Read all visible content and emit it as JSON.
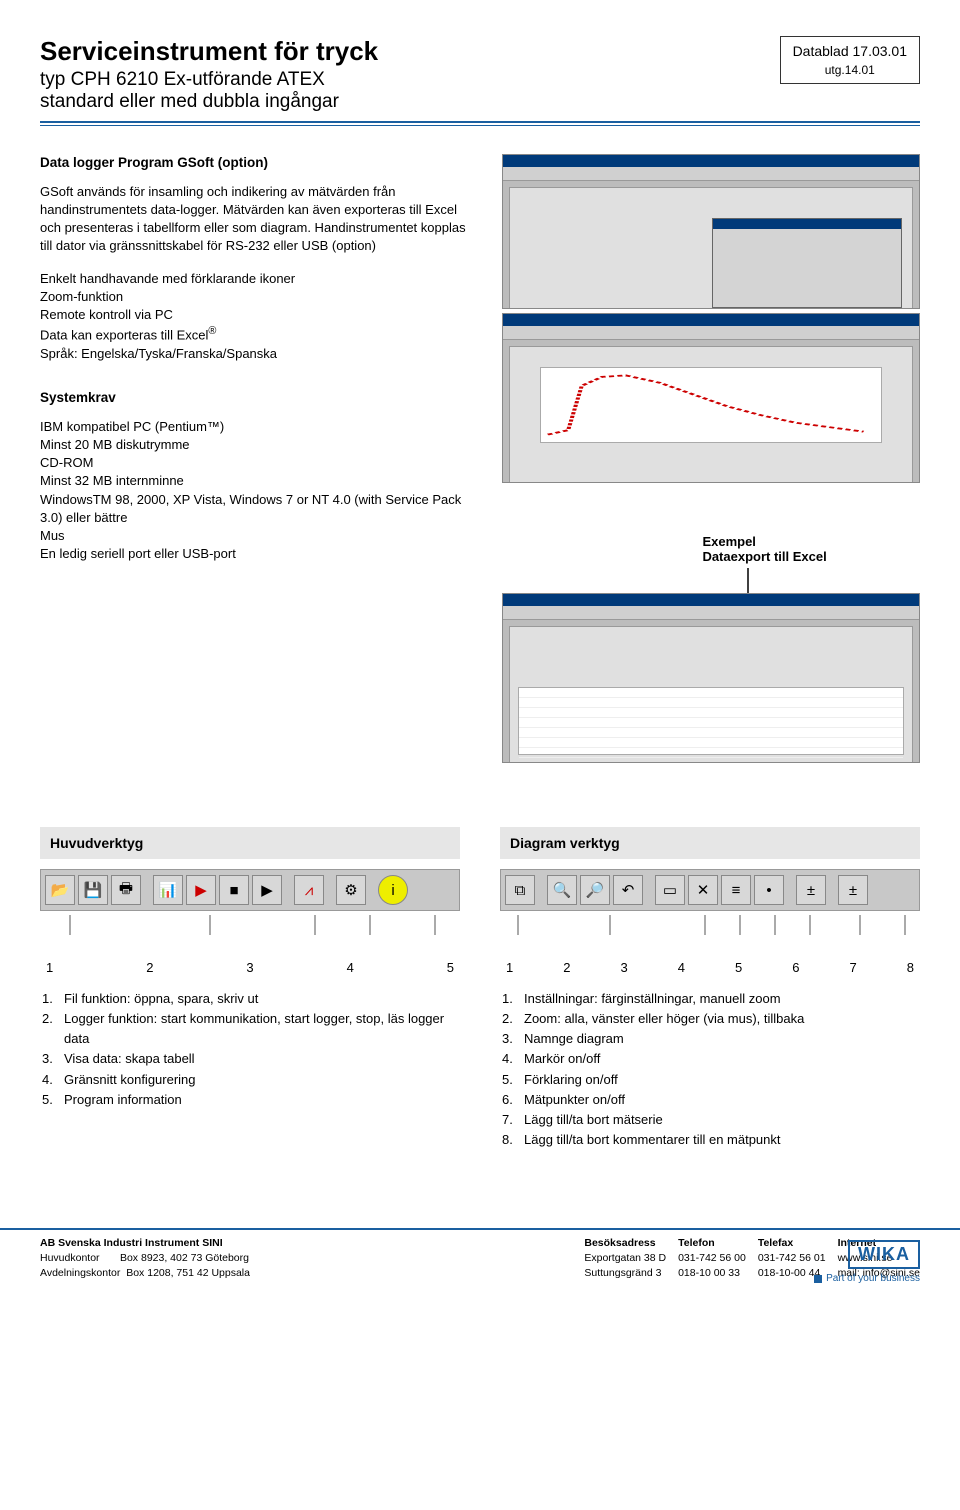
{
  "header": {
    "title": "Serviceinstrument för tryck",
    "subtitle1": "typ CPH 6210 Ex-utförande ATEX",
    "subtitle2": "standard eller med dubbla ingångar",
    "datablad": "Datablad 17.03.01",
    "utg": "utg.14.01"
  },
  "section1": {
    "heading": "Data logger Program GSoft (option)",
    "p1": "GSoft används för insamling och indikering av mätvärden från handinstrumentets data-logger. Mätvärden kan även exporteras till Excel och presenteras i tabellform eller som diagram. Handinstrumentet kopplas till dator via gränssnittskabel för RS-232 eller USB (option)",
    "feat1": "Enkelt handhavande med förklarande ikoner",
    "feat2": "Zoom-funktion",
    "feat3": "Remote kontroll via PC",
    "feat4": "Data kan exporteras till Excel",
    "feat4_sup": "®",
    "feat5": "Språk: Engelska/Tyska/Franska/Spanska"
  },
  "section2": {
    "heading": "Systemkrav",
    "l1": "IBM kompatibel PC (Pentium™)",
    "l2": "Minst 20 MB diskutrymme",
    "l3": "CD-ROM",
    "l4": "Minst 32 MB internminne",
    "l5": "WindowsTM 98, 2000, XP Vista, Windows 7 or NT 4.0 (with Service Pack 3.0) eller bättre",
    "l6": "Mus",
    "l7": "En ledig seriell port eller USB-port"
  },
  "example": {
    "l1": "Exempel",
    "l2": "Dataexport till Excel"
  },
  "tools": {
    "left_header": "Huvudverktyg",
    "right_header": "Diagram verktyg",
    "left_nums": [
      "1",
      "2",
      "3",
      "4",
      "5"
    ],
    "right_nums": [
      "1",
      "2",
      "3",
      "4",
      "5",
      "6",
      "7",
      "8"
    ],
    "left_desc": [
      "Fil funktion: öppna, spara, skriv ut",
      "Logger funktion: start kommunikation, start logger, stop, läs logger data",
      "Visa data: skapa tabell",
      "Gränsnitt konfigurering",
      "Program information"
    ],
    "right_desc": [
      "Inställningar: färginställningar, manuell zoom",
      "Zoom: alla, vänster eller höger (via mus), tillbaka",
      "Namnge diagram",
      "Markör on/off",
      "Förklaring on/off",
      "Mätpunkter on/off",
      "Lägg till/ta bort mätserie",
      "Lägg till/ta bort kommentarer till en mätpunkt"
    ]
  },
  "footer": {
    "company": "AB Svenska Industri Instrument SINI",
    "hk_label": "Huvudkontor",
    "hk_val": "Box 8923, 402 73 Göteborg",
    "ak_label": "Avdelningskontor",
    "ak_val": "Box 1208, 751 42 Uppsala",
    "besok_h": "Besöksadress",
    "besok_1": "Exportgatan 38 D",
    "besok_2": "Suttungsgränd 3",
    "tel_h": "Telefon",
    "tel_1": "031-742 56 00",
    "tel_2": "018-10 00 33",
    "fax_h": "Telefax",
    "fax_1": "031-742 56 01",
    "fax_2": "018-10-00 44",
    "net_h": "Internet",
    "net_1": "www.sini.se",
    "net_2": "mail: info@sini.se",
    "logo": "WIKA",
    "tagline": "Part of your business"
  }
}
